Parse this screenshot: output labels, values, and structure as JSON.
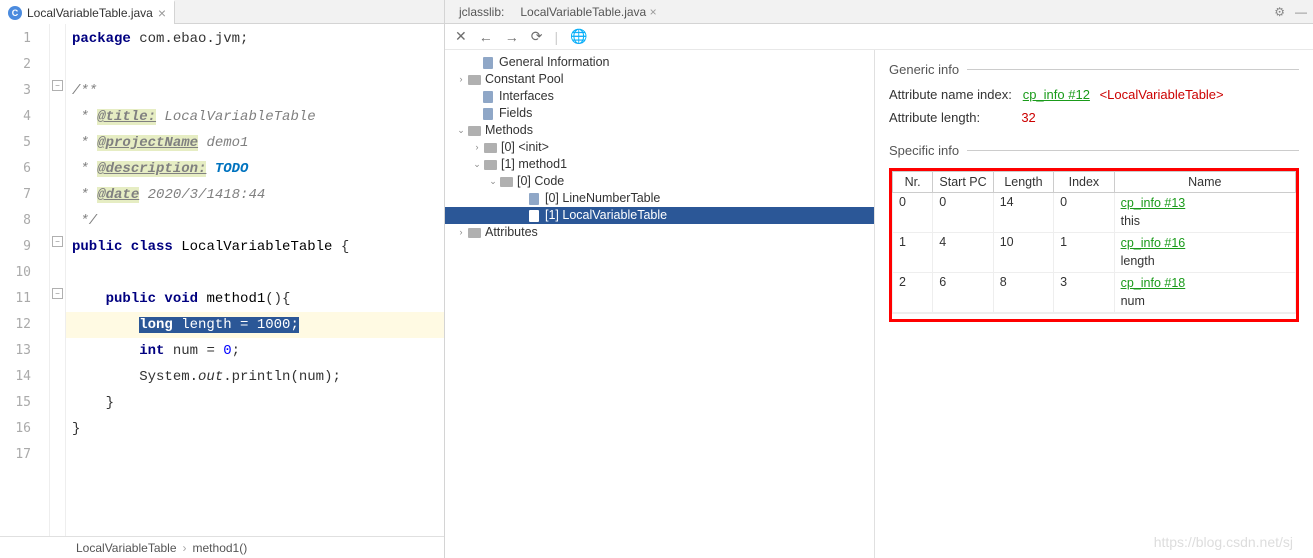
{
  "editor_tab": {
    "label": "LocalVariableTable.java"
  },
  "code_lines": [
    {
      "n": 1,
      "t": "package",
      "html": "<span class='kw'>package</span> com.ebao.jvm;"
    },
    {
      "n": 2,
      "t": "",
      "html": ""
    },
    {
      "n": 3,
      "t": "com",
      "html": "<span class='com'>/**</span>"
    },
    {
      "n": 4,
      "t": "com",
      "html": "<span class='com'> * </span><span class='tag'>@title:</span><span class='com'> LocalVariableTable</span>"
    },
    {
      "n": 5,
      "t": "com",
      "html": "<span class='com'> * </span><span class='tag'>@projectName</span><span class='com'> demo1</span>"
    },
    {
      "n": 6,
      "t": "com",
      "html": "<span class='com'> * </span><span class='tag'>@description:</span><span class='com'> </span><span class='todo'>TODO</span>"
    },
    {
      "n": 7,
      "t": "com",
      "html": "<span class='com'> * </span><span class='tag'>@date</span><span class='com'> 2020/3/1418:44</span>"
    },
    {
      "n": 8,
      "t": "com",
      "html": "<span class='com'> */</span>"
    },
    {
      "n": 9,
      "t": "",
      "html": "<span class='kw'>public class</span> <span class='idn'>LocalVariableTable</span> {"
    },
    {
      "n": 10,
      "t": "",
      "html": ""
    },
    {
      "n": 11,
      "t": "",
      "html": "    <span class='kw'>public void</span> <span class='idn'>method1</span>(){"
    },
    {
      "n": 12,
      "t": "hl",
      "html": "        <span class='sel'><span style='font-weight:bold'>long</span> length = 1000;</span>"
    },
    {
      "n": 13,
      "t": "",
      "html": "        <span class='kw'>int</span> num = <span class='num'>0</span>;"
    },
    {
      "n": 14,
      "t": "",
      "html": "        System.<span class='str-it'>out</span>.println(num);"
    },
    {
      "n": 15,
      "t": "",
      "html": "    }"
    },
    {
      "n": 16,
      "t": "",
      "html": "}"
    },
    {
      "n": 17,
      "t": "",
      "html": ""
    }
  ],
  "breadcrumb": {
    "a": "LocalVariableTable",
    "b": "method1()"
  },
  "right_tabs": {
    "jclasslib": "jclasslib:",
    "file": "LocalVariableTable.java"
  },
  "tree": [
    {
      "indent": 14,
      "arrow": "",
      "ico": "file",
      "label": "General Information"
    },
    {
      "indent": 0,
      "arrow": "›",
      "ico": "folder",
      "label": "Constant Pool"
    },
    {
      "indent": 14,
      "arrow": "",
      "ico": "file",
      "label": "Interfaces"
    },
    {
      "indent": 14,
      "arrow": "",
      "ico": "file",
      "label": "Fields"
    },
    {
      "indent": 0,
      "arrow": "⌄",
      "ico": "folder",
      "label": "Methods"
    },
    {
      "indent": 16,
      "arrow": "›",
      "ico": "folder",
      "label": "[0] <init>"
    },
    {
      "indent": 16,
      "arrow": "⌄",
      "ico": "folder",
      "label": "[1] method1"
    },
    {
      "indent": 32,
      "arrow": "⌄",
      "ico": "folder",
      "label": "[0] Code"
    },
    {
      "indent": 60,
      "arrow": "",
      "ico": "file",
      "label": "[0] LineNumberTable"
    },
    {
      "indent": 60,
      "arrow": "",
      "ico": "file",
      "label": "[1] LocalVariableTable",
      "sel": true
    },
    {
      "indent": 0,
      "arrow": "›",
      "ico": "folder",
      "label": "Attributes"
    }
  ],
  "generic_info": {
    "title": "Generic info",
    "attr_name_label": "Attribute name index:",
    "attr_name_link": "cp_info #12",
    "attr_name_desc": "<LocalVariableTable>",
    "attr_len_label": "Attribute length:",
    "attr_len_value": "32"
  },
  "specific_info": {
    "title": "Specific info",
    "headers": [
      "Nr.",
      "Start PC",
      "Length",
      "Index",
      "Name"
    ],
    "rows": [
      {
        "nr": "0",
        "startpc": "0",
        "length": "14",
        "index": "0",
        "link": "cp_info #13",
        "name": "this"
      },
      {
        "nr": "1",
        "startpc": "4",
        "length": "10",
        "index": "1",
        "link": "cp_info #16",
        "name": "length"
      },
      {
        "nr": "2",
        "startpc": "6",
        "length": "8",
        "index": "3",
        "link": "cp_info #18",
        "name": "num"
      }
    ]
  },
  "watermark": "https://blog.csdn.net/sj"
}
